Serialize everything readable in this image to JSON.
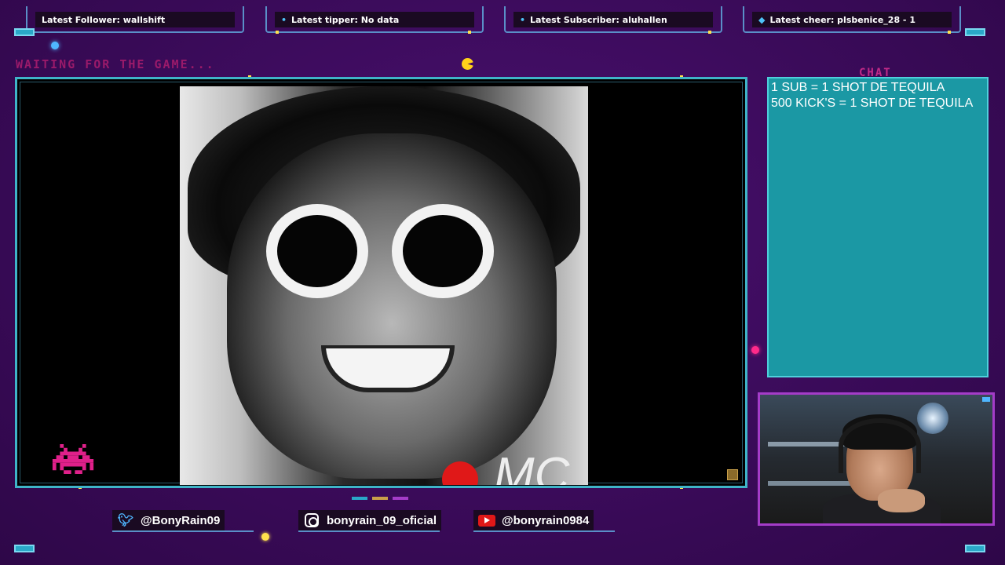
{
  "alerts": [
    {
      "label": "Latest Follower: wallshift"
    },
    {
      "label": "Latest tipper: No data"
    },
    {
      "label": "Latest Subscriber: aluhallen"
    },
    {
      "label": "Latest cheer: plsbenice_28 - 1"
    }
  ],
  "status_text": "WAITING FOR THE GAME...",
  "chat": {
    "label": "CHAT",
    "lines": [
      "1 SUB = 1 SHOT DE TEQUILA",
      "500 KICK'S = 1 SHOT DE TEQUILA"
    ]
  },
  "game_overlay_text": "MC",
  "socials": {
    "twitter": "@BonyRain09",
    "instagram": "bonyrain_09_oficial",
    "youtube": "@bonyrain0984"
  },
  "colors": {
    "background": "#3c0a5c",
    "frame_cyan": "#3fb4c8",
    "chat_bg": "#1b98a4",
    "cam_border": "#a43cc8",
    "accent_pink": "#c22a88",
    "accent_yellow": "#ffe14d"
  },
  "icons": {
    "twitter": "twitter-bird-icon",
    "instagram": "instagram-icon",
    "youtube": "youtube-play-icon",
    "cheer": "diamond-icon"
  }
}
